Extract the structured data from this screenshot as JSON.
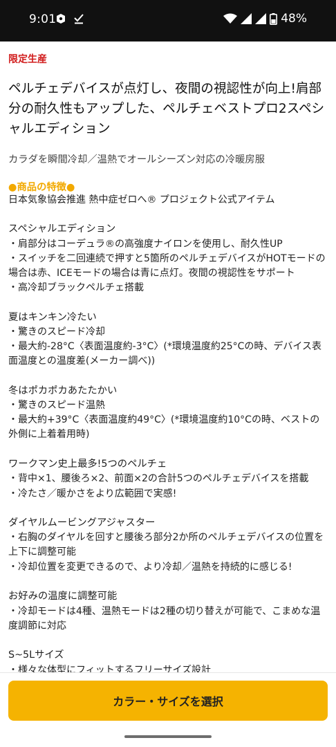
{
  "status": {
    "time": "9:01",
    "battery": "48%"
  },
  "product": {
    "badge": "限定生産",
    "title": "ペルチェデバイスが点灯し、夜間の視認性が向上!肩部分の耐久性もアップした、ペルチェベストプロ2スペシャルエディション",
    "subtitle": "カラダを瞬間冷却／温熱でオールシーズン対応の冷暖房服",
    "features_heading": "●商品の特徴●",
    "lines": [
      "日本気象協会推進 熱中症ゼロへ® プロジェクト公式アイテム",
      "スペシャルエディション",
      "・肩部分はコーデュラ®の高強度ナイロンを使用し、耐久性UP",
      "・スイッチを二回連続で押すと5箇所のペルチェデバイスがHOTモードの場合は赤、ICEモードの場合は青に点灯。夜間の視認性をサポート",
      "・高冷却ブラックペルチェ搭載",
      "夏はキンキン冷たい",
      "・驚きのスピード冷却",
      "・最大約-28°C〈表面温度約-3°C〉(*環境温度約25°Cの時、デバイス表面温度との温度差(メーカー調べ))",
      "冬はポカポカあたたかい",
      "・驚きのスピード温熱",
      "・最大約+39°C〈表面温度約49°C〉(*環境温度約10°Cの時、ベストの外側に上着着用時)",
      "ワークマン史上最多!5つのペルチェ",
      "・背中×1、腰後ろ×2、前面×2の合計5つのペルチェデバイスを搭載",
      "・冷たさ／暖かさをより広範囲で実感!",
      "ダイヤルムービングアジャスター",
      "・右胸のダイヤルを回すと腰後ろ部分2か所のペルチェデバイスの位置を上下に調整可能",
      "・冷却位置を変更できるので、より冷却／温熱を持続的に感じる!",
      "お好みの温度に調整可能",
      "・冷却モードは4種、温熱モードは2種の切り替えが可能で、こまめな温度調節に対応",
      "S~5Lサイズ",
      "・様々な体型にフィットするフリーサイズ設計"
    ]
  },
  "cta": {
    "label": "カラー・サイズを選択"
  },
  "colors": {
    "accent": "#f5b301",
    "badge": "#d11b1b",
    "feature_heading": "#f2a900"
  }
}
